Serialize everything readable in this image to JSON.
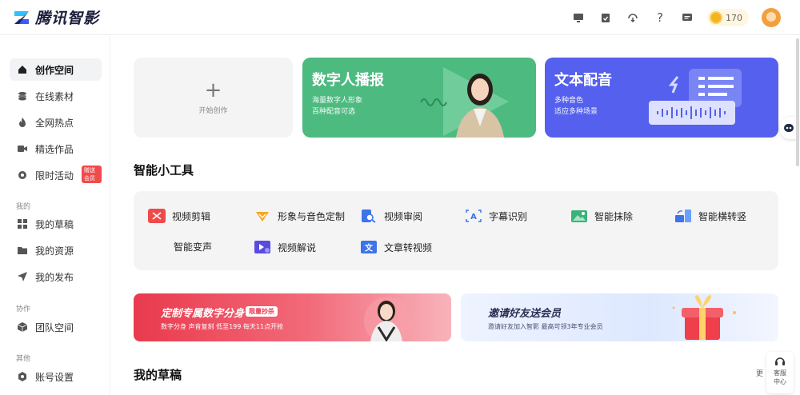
{
  "app": {
    "title": "腾讯智影"
  },
  "header": {
    "coin_count": "170",
    "icons": [
      "screen-icon",
      "clipboard-icon",
      "download-icon",
      "help-icon",
      "message-icon"
    ]
  },
  "sidebar": {
    "items": [
      {
        "label": "创作空间",
        "icon": "home-icon",
        "active": true
      },
      {
        "label": "在线素材",
        "icon": "layers-icon"
      },
      {
        "label": "全网热点",
        "icon": "flame-icon"
      },
      {
        "label": "精选作品",
        "icon": "video-icon"
      },
      {
        "label": "限时活动",
        "icon": "gear-icon",
        "badge": "赠送会员"
      }
    ],
    "group_mine": "我的",
    "mine_items": [
      {
        "label": "我的草稿",
        "icon": "grid-icon"
      },
      {
        "label": "我的资源",
        "icon": "folder-icon"
      },
      {
        "label": "我的发布",
        "icon": "send-icon"
      }
    ],
    "group_collab": "协作",
    "collab_items": [
      {
        "label": "团队空间",
        "icon": "box-icon"
      }
    ],
    "group_other": "其他",
    "other_items": [
      {
        "label": "账号设置",
        "icon": "settings-icon"
      }
    ]
  },
  "cards": {
    "new": {
      "label": "开始创作"
    },
    "digital": {
      "title": "数字人播报",
      "line1": "海量数字人形象",
      "line2": "百种配音可选"
    },
    "tts": {
      "title": "文本配音",
      "line1": "多种音色",
      "line2": "适应多种场景"
    }
  },
  "tools_title": "智能小工具",
  "tools": [
    {
      "label": "视频剪辑",
      "icon": "scissors-icon",
      "color": "#ee4a4a"
    },
    {
      "label": "形象与音色定制",
      "icon": "diamond-icon",
      "color": "#f5a623"
    },
    {
      "label": "视频审阅",
      "icon": "review-icon",
      "color": "#3d74e8"
    },
    {
      "label": "字幕识别",
      "icon": "caption-icon",
      "color": "#3d74e8"
    },
    {
      "label": "智能抹除",
      "icon": "image-erase-icon",
      "color": "#3bb27a"
    },
    {
      "label": "智能横转竖",
      "icon": "rotate-icon",
      "color": "#3d74e8"
    },
    {
      "label": "智能变声",
      "icon": "",
      "color": ""
    },
    {
      "label": "视频解说",
      "icon": "narration-icon",
      "color": "#5a4be0"
    },
    {
      "label": "文章转视频",
      "icon": "article-video-icon",
      "color": "#3d74e8"
    }
  ],
  "banners": {
    "red": {
      "title": "定制专属数字分身",
      "tag": "限量抄杀",
      "sub": "数字分身  声音复刻  低至199  每天11点开抢"
    },
    "blue": {
      "title": "邀请好友送会员",
      "sub": "邀请好友加入智影  最高可领3年专业会员"
    }
  },
  "drafts_title": "我的草稿",
  "more_label": "更",
  "service_label_1": "客服",
  "service_label_2": "中心"
}
